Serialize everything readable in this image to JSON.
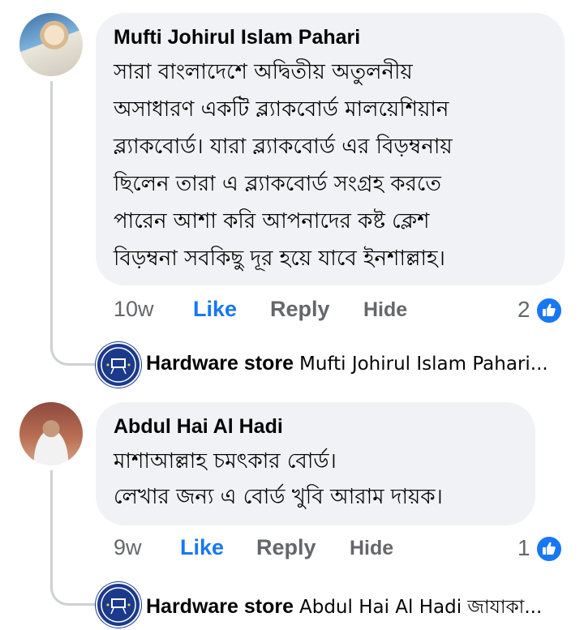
{
  "comments": [
    {
      "author": "Mufti Johirul Islam Pahari",
      "text_lines": [
        "সারা বাংলাদেশে অদ্বিতীয় অতুলনীয়",
        "অসাধারণ একটি ব্ল্যাকবোর্ড মালয়েশিয়ান",
        "ব্ল্যাকবোর্ড। যারা ব্ল্যাকবোর্ড এর বিড়ম্বনায়",
        "ছিলেন তারা এ ব্ল্যাকবোর্ড সংগ্রহ করতে",
        "পারেন আশা করি আপনাদের কষ্ট ক্লেশ",
        "বিড়ম্বনা সবকিছু দূর হয়ে যাবে ইনশাল্লাহ।"
      ],
      "time": "10w",
      "like_label": "Like",
      "reply_label": "Reply",
      "hide_label": "Hide",
      "reaction_count": "2",
      "reply": {
        "author": "Hardware store",
        "preview": "Mufti Johirul Islam Pahari..."
      }
    },
    {
      "author": "Abdul Hai Al Hadi",
      "text_lines": [
        "মাশাআল্লাহ চমৎকার বোর্ড।",
        "লেখার জন্য এ বোর্ড খুবি আরাম দায়ক।"
      ],
      "time": "9w",
      "like_label": "Like",
      "reply_label": "Reply",
      "hide_label": "Hide",
      "reaction_count": "1",
      "reply": {
        "author": "Hardware store",
        "preview": "Abdul Hai Al Hadi জাযাকা..."
      }
    }
  ],
  "icons": {
    "reaction": "like-thumb-icon",
    "store_logo": "hardware-store-logo"
  },
  "colors": {
    "bubble": "#f0f2f5",
    "like": "#1877f2",
    "meta": "#65676b",
    "thread_line": "#ced0d4"
  }
}
